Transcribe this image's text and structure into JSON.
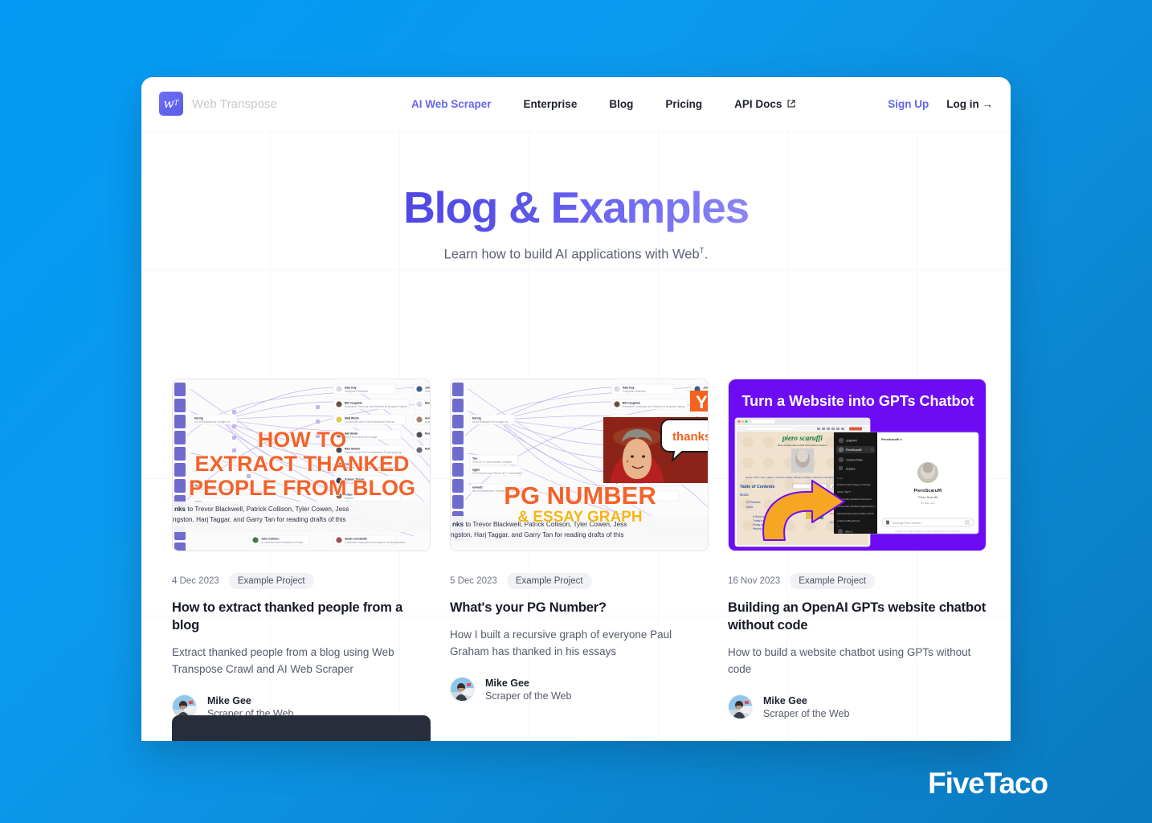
{
  "background": {
    "gradient_from": "#039BF5",
    "gradient_to": "#0B79BF"
  },
  "watermark": {
    "label": "FiveTaco"
  },
  "header": {
    "brand": {
      "logo_glyph": "w",
      "logo_sup": "T",
      "name": "Web Transpose"
    },
    "nav": [
      {
        "label": "AI Web Scraper",
        "active": true,
        "external": false
      },
      {
        "label": "Enterprise",
        "active": false,
        "external": false
      },
      {
        "label": "Blog",
        "active": false,
        "external": false
      },
      {
        "label": "Pricing",
        "active": false,
        "external": false
      },
      {
        "label": "API Docs",
        "active": false,
        "external": true
      }
    ],
    "actions": {
      "signup": "Sign Up",
      "login": "Log in →"
    }
  },
  "hero": {
    "title": "Blog & Examples",
    "subtitle_pre": "Learn how to build AI applications with Web",
    "subtitle_sup": "T",
    "subtitle_post": "."
  },
  "posts": [
    {
      "date": "4 Dec 2023",
      "tag": "Example Project",
      "title": "How to extract thanked people from a blog",
      "description": "Extract thanked people from a blog using Web Transpose Crawl and AI Web Scraper",
      "author": {
        "name": "Mike Gee",
        "role": "Scraper of the Web"
      },
      "thumbnail": {
        "overlay_line1": "HOW TO",
        "overlay_line2": "EXTRACT THANKED",
        "overlay_line3": "PEOPLE FROM BLOG",
        "overlay_color": "#F4622A",
        "caption": "nks to Trevor Blackwell, Patrick Collison, Tyler Cowen, Jess ngston, Harj Taggar, and Garry Tan for reading drafts of this"
      }
    },
    {
      "date": "5 Dec 2023",
      "tag": "Example Project",
      "title": "What's your PG Number?",
      "description": "How I built a recursive graph of everyone Paul Graham has thanked in his essays",
      "author": {
        "name": "Mike Gee",
        "role": "Scraper of the Web"
      },
      "thumbnail": {
        "overlay_line1": "PG NUMBER",
        "overlay_line2": "& ESSAY GRAPH",
        "overlay_color": "#F4622A",
        "overlay_color2": "#F5B417",
        "speech_bubble": "thanks",
        "caption": "nks to Trevor Blackwell, Patrick Collison, Tyler Cowen, Jess ngston, Harj Taggar, and Garry Tan for reading drafts of this"
      }
    },
    {
      "date": "16 Nov 2023",
      "tag": "Example Project",
      "title": "Building an OpenAI GPTs website chatbot without code",
      "description": "How to build a website chatbot using GPTs without code",
      "author": {
        "name": "Mike Gee",
        "role": "Scraper of the Web"
      },
      "thumbnail": {
        "headline": "Turn a Website into GPTs Chatbot",
        "background_color": "#6E0BF5",
        "site_title": "piero scaruffi",
        "toc_label": "Table of Contents",
        "chat_title": "PieroScaruffi",
        "chat_name": "Piero Scaruffi",
        "arrow_color": "#F5A623"
      }
    }
  ],
  "graph_nodes_col1": [
    "Alan Kay",
    "Bill Coughran",
    "Matt Welsh",
    "Hal Varian",
    "Ravi Mohan",
    "Aaron Swartz",
    "Kulveer Taggar",
    "Ankur Chen"
  ],
  "graph_nodes_col2": [
    "John Wilkes",
    "Mar Erlingsson",
    "Ann Farmer",
    "Reading",
    "Roberts"
  ],
  "graph_nodes_left": [
    "Norvig",
    "Tan",
    "aggar",
    "Iorwultz"
  ],
  "graph_nodes_bottom": [
    "John Collison",
    "Sarah Constantin"
  ]
}
